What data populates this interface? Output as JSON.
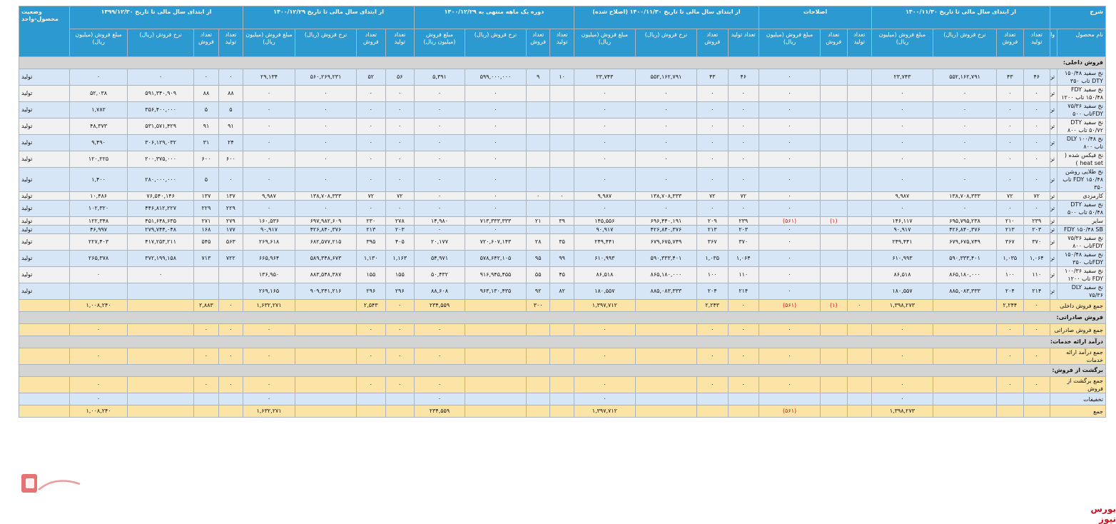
{
  "header": {
    "row1": [
      {
        "label": "شرح"
      },
      {
        "label": "از ابتدای سال مالی تا تاریخ ۱۴۰۰/۱۱/۳۰"
      },
      {
        "label": "اصلاحات"
      },
      {
        "label": "از ابتدای سال مالی تا تاریخ ۱۴۰۰/۱۱/۳۰ (اصلاح شده)"
      },
      {
        "label": "دوره یک ماهه منتهی به ۱۴۰۰/۱۲/۲۹"
      },
      {
        "label": "از ابتدای سال مالی تا تاریخ ۱۴۰۰/۱۲/۲۹"
      },
      {
        "label": "از ابتدای سال مالی تا تاریخ ۱۳۹۹/۱۲/۳۰"
      },
      {
        "label": "وضعیت محصول-واحد"
      }
    ],
    "row2": {
      "product_name": "نام محصول",
      "unit": "واحد",
      "prod_qty": "تعداد تولید",
      "sale_qty": "تعداد فروش",
      "rate": "نرخ فروش (ریال)",
      "amount": "مبلغ فروش (میلیون ریال)"
    }
  },
  "sections": {
    "domestic": "فروش داخلی:",
    "export": "فروش صادراتی:",
    "services": "درآمد ارائه خدمات:",
    "returns": "برگشت از فروش:"
  },
  "rows": [
    {
      "name": "نخ سفید ۱۵۰/۴۸ DTY تاب ۳۵۰",
      "unit": "تن",
      "status": "تولید",
      "style": "blue",
      "v": [
        "۴۶",
        "۴۳",
        "۵۵۲,۱۶۲,۷۹۱",
        "۲۳,۷۴۳",
        "",
        "",
        "٠",
        "۴۶",
        "۴۳",
        "۵۵۲,۱۶۲,۷۹۱",
        "۲۳,۷۴۳",
        "۱۰",
        "۹",
        "۵۹۹,۰۰۰,۰۰۰",
        "۵,۳۹۱",
        "۵۶",
        "۵۲",
        "۵۶۰,۲۶۹,۲۳۱",
        "۲۹,۱۳۴",
        "٠",
        "٠",
        "٠",
        "٠"
      ]
    },
    {
      "name": "نخ سفید FDY ۱۵۰/۴۸ تاب ۱۲۰۰",
      "unit": "تن",
      "status": "تولید",
      "style": "white",
      "v": [
        "٠",
        "٠",
        "٠",
        "٠",
        "",
        "",
        "٠",
        "٠",
        "٠",
        "٠",
        "٠",
        "",
        "",
        "٠",
        "٠",
        "٠",
        "٠",
        "٠",
        "٠",
        "۸۸",
        "۸۸",
        "۵۹۱,۳۴۰,۹۰۹",
        "۵۲,۰۳۸"
      ]
    },
    {
      "name": "نخ سفید ۷۵/۳۶ FDYتاب ۵۰۰",
      "unit": "تن",
      "status": "تولید",
      "style": "blue",
      "v": [
        "٠",
        "٠",
        "٠",
        "٠",
        "",
        "",
        "٠",
        "٠",
        "٠",
        "٠",
        "٠",
        "",
        "",
        "٠",
        "٠",
        "٠",
        "٠",
        "٠",
        "٠",
        "۵",
        "۵",
        "۳۵۶,۴۰۰,۰۰۰",
        "۱,۷۸۲"
      ]
    },
    {
      "name": "نخ سفید DTY ۵۰/۷۲ تاب ۸۰۰",
      "unit": "تن",
      "status": "تولید",
      "style": "white",
      "v": [
        "٠",
        "٠",
        "٠",
        "٠",
        "",
        "",
        "٠",
        "٠",
        "٠",
        "٠",
        "٠",
        "",
        "",
        "٠",
        "٠",
        "٠",
        "٠",
        "٠",
        "٠",
        "۹۱",
        "۹۱",
        "۵۳۱,۵۷۱,۴۲۹",
        "۴۸,۳۷۳"
      ]
    },
    {
      "name": "نخ ۱۰۰/۴۸ DLY تاب ۸۰۰",
      "unit": "تن",
      "status": "تولید",
      "style": "blue",
      "v": [
        "٠",
        "٠",
        "٠",
        "٠",
        "",
        "",
        "٠",
        "٠",
        "٠",
        "٠",
        "٠",
        "",
        "",
        "٠",
        "٠",
        "٠",
        "٠",
        "٠",
        "٠",
        "۲۴",
        "۳۱",
        "۳۰۶,۱۲۹,۰۳۲",
        "۹,۴۹۰"
      ]
    },
    {
      "name": "نخ فیکس شده ( heat set )",
      "unit": "تن",
      "status": "تولید",
      "style": "white",
      "v": [
        "٠",
        "٠",
        "٠",
        "٠",
        "",
        "",
        "٠",
        "٠",
        "٠",
        "٠",
        "٠",
        "",
        "",
        "٠",
        "٠",
        "٠",
        "٠",
        "٠",
        "٠",
        "۶۰۰",
        "۶۰۰",
        "۲۰۰,۳۷۵,۰۰۰",
        "۱۲۰,۲۲۵"
      ]
    },
    {
      "name": "نخ طلایی روشن ۱۵۰/۴۸ FDY تاب ۳۵۰",
      "unit": "تن",
      "status": "تولید",
      "style": "blue",
      "v": [
        "٠",
        "٠",
        "٠",
        "٠",
        "",
        "",
        "٠",
        "٠",
        "٠",
        "٠",
        "٠",
        "",
        "",
        "٠",
        "٠",
        "٠",
        "٠",
        "٠",
        "٠",
        "٠",
        "۵",
        "۲۸۰,۰۰۰,۰۰۰",
        "۱,۴۰۰"
      ]
    },
    {
      "name": "کارمزدی",
      "unit": "تن",
      "status": "تولید",
      "style": "white",
      "v": [
        "۷۲",
        "۷۲",
        "۱۳۸,۷۰۸,۳۳۳",
        "۹,۹۸۷",
        "",
        "",
        "٠",
        "۷۲",
        "۷۲",
        "۱۳۸,۷۰۸,۳۳۳",
        "۹,۹۸۷",
        "٠",
        "٠",
        "٠",
        "٠",
        "۷۲",
        "۷۲",
        "۱۳۸,۷۰۸,۳۳۳",
        "۹,۹۸۷",
        "۱۳۷",
        "۱۳۷",
        "۷۶,۵۴۰,۱۴۶",
        "۱۰,۴۸۶"
      ]
    },
    {
      "name": "نخ سفید DTY ۵۰/۴۸ تاب ۵۰۰",
      "unit": "تن",
      "status": "تولید",
      "style": "blue",
      "v": [
        "٠",
        "٠",
        "٠",
        "٠",
        "",
        "",
        "٠",
        "٠",
        "٠",
        "٠",
        "٠",
        "",
        "",
        "٠",
        "٠",
        "٠",
        "٠",
        "٠",
        "٠",
        "۲۲۹",
        "۲۲۹",
        "۴۴۶,۸۱۲,۲۲۷",
        "۱۰۲,۳۲۰"
      ]
    },
    {
      "name": "سایر",
      "unit": "تن",
      "status": "تولید",
      "style": "white",
      "v": [
        "۲۳۹",
        "۲۱۰",
        "۶۹۵,۷۹۵,۲۳۸",
        "۱۴۶,۱۱۷",
        "",
        "(۱)",
        "(۵۶۱)",
        "۲۳۹",
        "۲۰۹",
        "۶۹۶,۴۴۰,۱۹۱",
        "۱۴۵,۵۵۶",
        "۳۹",
        "۲۱",
        "۷۱۳,۳۳۳,۳۳۳",
        "۱۴,۹۸۰",
        "۲۷۸",
        "۲۳۰",
        "۶۹۷,۹۸۲,۶۰۹",
        "۱۶۰,۵۳۶",
        "۲۷۹",
        "۲۷۱",
        "۴۵۱,۶۴۸,۶۳۵",
        "۱۲۲,۳۴۸"
      ]
    },
    {
      "name": "FDY ۱۵۰/۴۸ SB",
      "unit": "تن",
      "status": "تولید",
      "style": "blue",
      "v": [
        "۲۰۳",
        "۲۱۳",
        "۴۲۶,۸۴۰,۳۷۶",
        "۹۰,۹۱۷",
        "",
        "",
        "٠",
        "۲۰۳",
        "۲۱۳",
        "۴۲۶,۸۴۰,۳۷۶",
        "۹۰,۹۱۷",
        "",
        "",
        "٠",
        "٠",
        "۲۰۳",
        "۲۱۳",
        "۴۲۶,۸۴۰,۳۷۶",
        "۹۰,۹۱۷",
        "۱۷۷",
        "۱۶۸",
        "۲۷۹,۷۴۴,۰۴۸",
        "۴۶,۹۹۷"
      ]
    },
    {
      "name": "نخ سفید ۷۵/۳۶ FDYتاب ۸۰۰",
      "unit": "تن",
      "status": "تولید",
      "style": "white",
      "v": [
        "۳۷۰",
        "۳۶۷",
        "۶۷۹,۶۷۵,۷۴۹",
        "۲۴۹,۴۴۱",
        "",
        "",
        "٠",
        "۳۷۰",
        "۳۶۷",
        "۶۷۹,۶۷۵,۷۴۹",
        "۲۴۹,۴۴۱",
        "۳۵",
        "۲۸",
        "۷۲۰,۶۰۷,۱۴۳",
        "۲۰,۱۷۷",
        "۴۰۵",
        "۳۹۵",
        "۶۸۲,۵۷۷,۲۱۵",
        "۲۶۹,۶۱۸",
        "۵۶۳",
        "۵۴۵",
        "۴۱۷,۲۵۳,۲۱۱",
        "۲۲۷,۴۰۳"
      ]
    },
    {
      "name": "نخ سفید ۱۵۰/۴۸ FDYتاب ۳۵۰",
      "unit": "تن",
      "status": "تولید",
      "style": "blue",
      "v": [
        "۱,۰۶۴",
        "۱,۰۳۵",
        "۵۹۰,۳۳۳,۴۰۱",
        "۶۱۰,۹۹۳",
        "",
        "",
        "٠",
        "۱,۰۶۴",
        "۱,۰۳۵",
        "۵۹۰,۳۳۳,۴۰۱",
        "۶۱۰,۹۹۳",
        "۹۹",
        "۹۵",
        "۵۷۸,۶۴۲,۱۰۵",
        "۵۴,۹۷۱",
        "۱,۱۶۳",
        "۱,۱۳۰",
        "۵۸۹,۳۴۸,۶۷۳",
        "۶۶۵,۹۶۴",
        "۷۲۲",
        "۷۱۳",
        "۳۷۲,۱۹۹,۱۵۸",
        "۲۶۵,۳۷۸"
      ]
    },
    {
      "name": "نخ سفید ۱۰۰/۳۶ FDY تاب ۱۲۰۰",
      "unit": "تن",
      "status": "تولید",
      "style": "white",
      "v": [
        "۱۱۰",
        "۱۰۰",
        "۸۶۵,۱۸۰,۰۰۰",
        "۸۶,۵۱۸",
        "",
        "",
        "٠",
        "۱۱۰",
        "۱۰۰",
        "۸۶۵,۱۸۰,۰۰۰",
        "۸۶,۵۱۸",
        "۴۵",
        "۵۵",
        "۹۱۶,۹۴۵,۴۵۵",
        "۵۰,۴۳۲",
        "۱۵۵",
        "۱۵۵",
        "۸۸۳,۵۴۸,۳۸۷",
        "۱۳۶,۹۵۰",
        "",
        "",
        "٠",
        "٠"
      ]
    },
    {
      "name": "نخ سفید DLY ۷۵/۳۶",
      "unit": "تن",
      "status": "تولید",
      "style": "blue",
      "v": [
        "۲۱۴",
        "۲۰۴",
        "۸۸۵,۰۸۳,۳۳۳",
        "۱۸۰,۵۵۷",
        "",
        "",
        "٠",
        "۲۱۴",
        "۲۰۴",
        "۸۸۵,۰۸۳,۳۳۳",
        "۱۸۰,۵۵۷",
        "۸۲",
        "۹۲",
        "۹۶۳,۱۳۰,۴۳۵",
        "۸۸,۶۰۸",
        "۲۹۶",
        "۲۹۶",
        "۹۰۹,۳۴۱,۲۱۶",
        "۲۶۹,۱۶۵",
        "",
        "",
        "",
        ""
      ]
    }
  ],
  "totals": {
    "domestic": {
      "label": "جمع فروش داخلی",
      "v": [
        "٠",
        "۲,۲۴۴",
        "",
        "۱,۳۹۸,۲۷۳",
        "٠",
        "(۱)",
        "(۵۶۱)",
        "٠",
        "۲,۲۴۳",
        "",
        "۱,۳۹۷,۷۱۲",
        "",
        "۳۰۰",
        "",
        "۲۳۴,۵۵۹",
        "٠",
        "۲,۵۴۳",
        "",
        "۱,۶۳۲,۲۷۱",
        "٠",
        "۲,۸۸۳",
        "",
        "۱,۰۰۸,۲۴۰"
      ]
    },
    "export": {
      "label": "جمع فروش صادراتی",
      "v": [
        "٠",
        "٠",
        "",
        "٠",
        "",
        "",
        "٠",
        "٠",
        "٠",
        "",
        "٠",
        "",
        "",
        "",
        "٠",
        "٠",
        "٠",
        "",
        "٠",
        "٠",
        "٠",
        "",
        "٠"
      ]
    },
    "services": {
      "label": "جمع درآمد ارائه خدمات",
      "v": [
        "٠",
        "٠",
        "",
        "٠",
        "",
        "",
        "٠",
        "٠",
        "٠",
        "",
        "٠",
        "",
        "",
        "",
        "٠",
        "٠",
        "٠",
        "",
        "٠",
        "٠",
        "٠",
        "",
        "٠"
      ]
    },
    "returns": {
      "label": "جمع برگشت از فروش",
      "v": [
        "٠",
        "٠",
        "",
        "٠",
        "",
        "",
        "٠",
        "٠",
        "٠",
        "",
        "٠",
        "",
        "",
        "",
        "٠",
        "٠",
        "٠",
        "",
        "٠",
        "٠",
        "٠",
        "",
        "٠"
      ]
    },
    "discounts": {
      "label": "تخفیفات",
      "v": [
        "",
        "",
        "",
        "٠",
        "",
        "",
        "",
        "",
        "",
        "",
        "٠",
        "",
        "",
        "",
        "٠",
        "",
        "",
        "",
        "٠",
        "",
        "",
        "",
        "٠"
      ]
    },
    "grand": {
      "label": "جمع",
      "v": [
        "",
        "",
        "",
        "۱,۳۹۸,۲۷۳",
        "",
        "",
        "(۵۶۱)",
        "",
        "",
        "",
        "۱,۳۹۷,۷۱۲",
        "",
        "",
        "",
        "۲۳۴,۵۵۹",
        "",
        "",
        "",
        "۱,۶۳۲,۲۷۱",
        "",
        "",
        "",
        "۱,۰۰۸,۲۴۰"
      ]
    }
  },
  "brand": {
    "footer": "بورس نیوز",
    "logo_text": "بورس نیوز"
  },
  "colors": {
    "header": "#2c9ad0",
    "row_blue": "#d7e6f6",
    "row_alt": "#f1f1f1",
    "section": "#d4d4d4",
    "total": "#fce3a6",
    "negative": "#d41c1c",
    "brand_red": "#c8141e"
  }
}
